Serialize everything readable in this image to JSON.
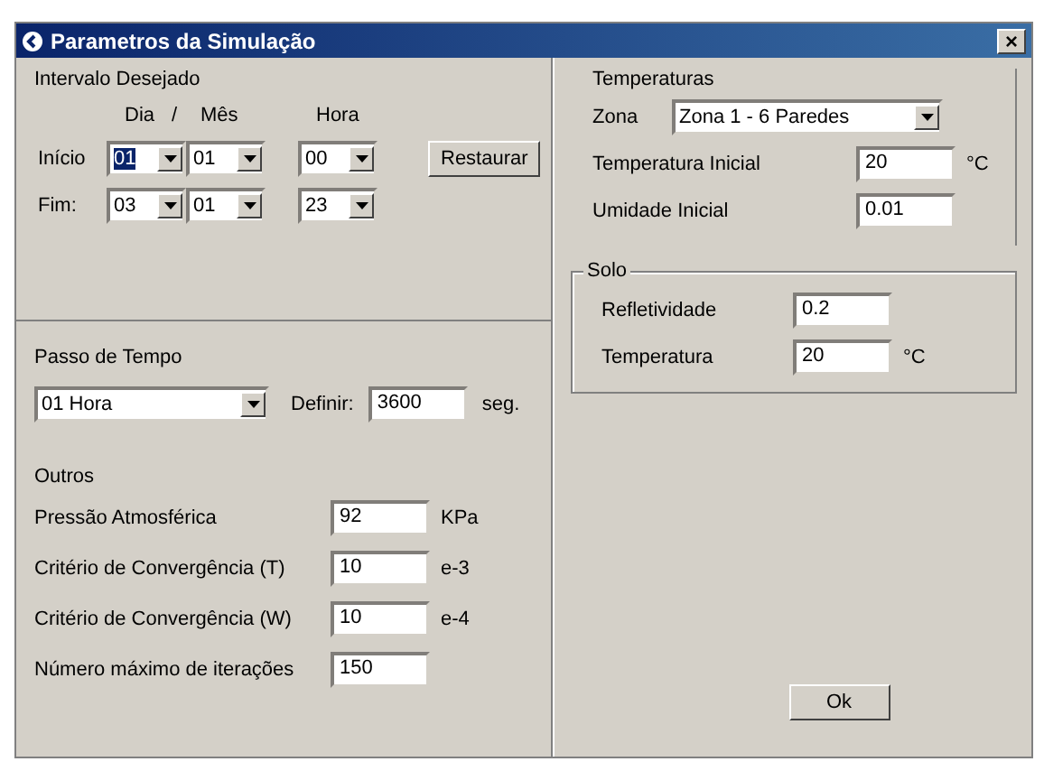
{
  "window": {
    "title": "Parametros da Simulação",
    "close": "×"
  },
  "intervalo": {
    "title": "Intervalo Desejado",
    "headers": [
      "Dia",
      "/",
      "Mês",
      "Hora"
    ],
    "rows": [
      {
        "label": "Início",
        "combos": [
          {
            "value": "01",
            "highlighted": true
          },
          {
            "value": "01",
            "highlighted": false
          },
          {
            "value": "00",
            "highlighted": false
          }
        ]
      },
      {
        "label": "Fim:",
        "combos": [
          {
            "value": "03",
            "highlighted": false
          },
          {
            "value": "01",
            "highlighted": false
          },
          {
            "value": "23",
            "highlighted": false
          }
        ]
      }
    ],
    "button": "Restaurar"
  },
  "passo": {
    "title": "Passo de Tempo",
    "combo": "01 Hora",
    "label": "Definir:",
    "value": "3600",
    "unit": "seg."
  },
  "outros": {
    "title": "Outros",
    "fields": [
      {
        "label": "Pressão Atmosférica",
        "value": "92",
        "unit": "KPa"
      },
      {
        "label": "Critério de Convergência (T)",
        "value": "10",
        "unit": "e-3"
      },
      {
        "label": "Critério de Convergência (W)",
        "value": "10",
        "unit": "e-4"
      },
      {
        "label": "Número máximo de iterações",
        "value": "150"
      }
    ]
  },
  "temperaturas": {
    "title": "Temperaturas",
    "zona_label": "Zona",
    "zona": "Zona 1 - 6 Paredes",
    "fields": [
      {
        "label": "Temperatura Inicial",
        "value": "20",
        "unit": "°C"
      },
      {
        "label": "Umidade Inicial",
        "value": "0.01"
      }
    ]
  },
  "solo": {
    "title": "Solo",
    "fields": [
      {
        "label": "Refletividade",
        "value": "0.2"
      },
      {
        "label": "Temperatura",
        "value": "20",
        "unit": "°C"
      }
    ]
  },
  "ok_button": "Ok"
}
